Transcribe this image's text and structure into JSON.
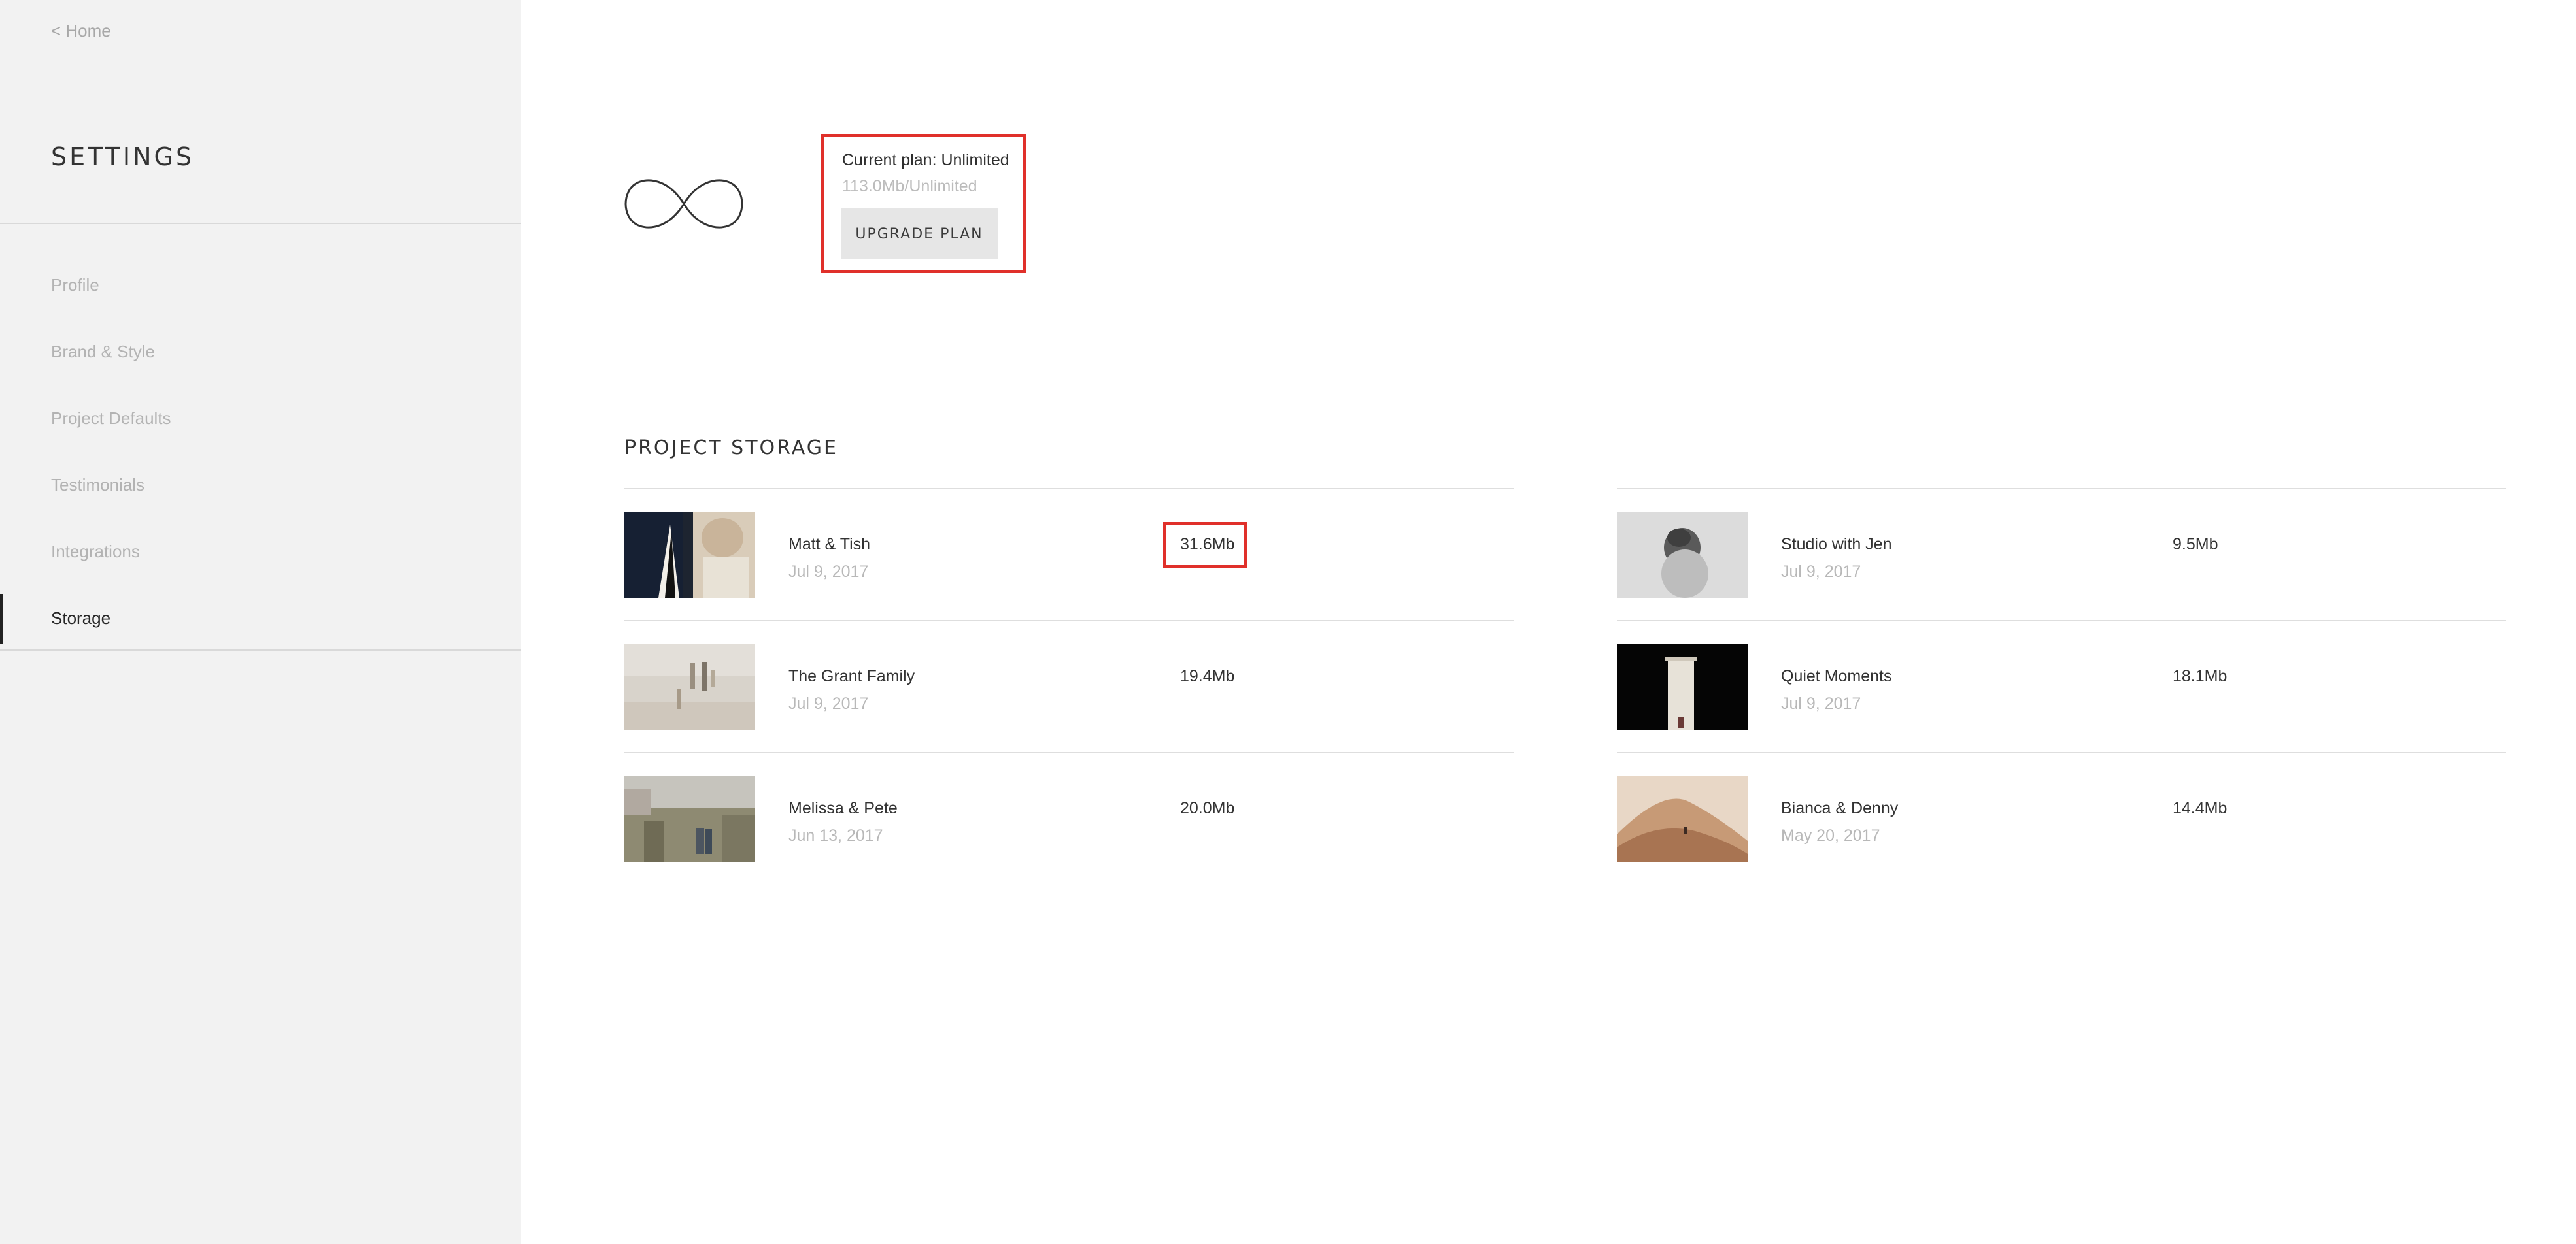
{
  "sidebar": {
    "home_link": "< Home",
    "title": "SETTINGS",
    "items": [
      {
        "label": "Profile",
        "active": false
      },
      {
        "label": "Brand & Style",
        "active": false
      },
      {
        "label": "Project Defaults",
        "active": false
      },
      {
        "label": "Testimonials",
        "active": false
      },
      {
        "label": "Integrations",
        "active": false
      },
      {
        "label": "Storage",
        "active": true
      }
    ]
  },
  "plan": {
    "icon": "infinity-icon",
    "name": "Current plan: Unlimited",
    "usage": "113.0Mb/Unlimited",
    "upgrade_label": "UPGRADE PLAN",
    "highlight_color": "#e0302a"
  },
  "storage": {
    "title": "PROJECT STORAGE",
    "left": [
      {
        "name": "Matt & Tish",
        "date": "Jul 9, 2017",
        "size": "31.6Mb",
        "highlighted": true
      },
      {
        "name": "The Grant Family",
        "date": "Jul 9, 2017",
        "size": "19.4Mb"
      },
      {
        "name": "Melissa & Pete",
        "date": "Jun 13, 2017",
        "size": "20.0Mb"
      }
    ],
    "right": [
      {
        "name": "Studio with Jen",
        "date": "Jul 9, 2017",
        "size": "9.5Mb"
      },
      {
        "name": "Quiet Moments",
        "date": "Jul 9, 2017",
        "size": "18.1Mb"
      },
      {
        "name": "Bianca & Denny",
        "date": "May 20, 2017",
        "size": "14.4Mb"
      }
    ]
  }
}
